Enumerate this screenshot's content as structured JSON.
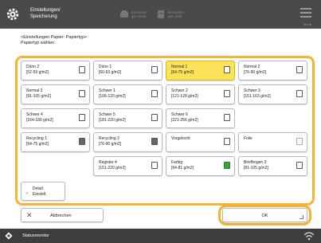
{
  "header": {
    "title_line1": "Einstellungen/",
    "title_line2": "Speicherung",
    "btn1_line1": "Einstellun-",
    "btn1_line2": "gen kontr.",
    "btn2_line1": "Einstellun-",
    "btn2_line2": "gen abbr.",
    "menu_label": "Menü"
  },
  "instructions": {
    "line1": "<Einstellungen Papier: Papiertyp>",
    "line2": "Papiertyp wählen."
  },
  "paper_types": [
    {
      "name": "Dünn 2",
      "range": "[52-59 g/m2]",
      "selected": false
    },
    {
      "name": "Dünn 1",
      "range": "[60-63 g/m2]",
      "selected": false
    },
    {
      "name": "Normal 1",
      "range": "[64-75 g/m2]",
      "selected": true
    },
    {
      "name": "Normal 2",
      "range": "[76-90 g/m2]",
      "selected": false
    },
    {
      "name": "Normal 3",
      "range": "[91-105 g/m2]",
      "selected": false
    },
    {
      "name": "Schwer 1",
      "range": "[106-120 g/m2]",
      "selected": false
    },
    {
      "name": "Schwer 2",
      "range": "[121-128 g/m2]",
      "selected": false
    },
    {
      "name": "Schwer 3",
      "range": "[151-163 g/m2]",
      "selected": false
    },
    {
      "name": "Schwer 4",
      "range": "[164-180 g/m2]",
      "selected": false
    },
    {
      "name": "Schwer 5",
      "range": "[181-220 g/m2]",
      "selected": false
    },
    {
      "name": "Schwer 6",
      "range": "[221-256 g/m2]",
      "selected": false
    },
    {
      "name": "",
      "range": "",
      "selected": false
    },
    {
      "name": "Recycling 1",
      "range": "[64-75 g/m2]",
      "selected": false
    },
    {
      "name": "Recycling 2",
      "range": "[76-90 g/m2]",
      "selected": false
    },
    {
      "name": "Vorgelocht",
      "range": "",
      "selected": false
    },
    {
      "name": "Folie",
      "range": "",
      "selected": false
    },
    {
      "name": "",
      "range": "",
      "selected": false
    },
    {
      "name": "Register 4",
      "range": "[151-220 g/m2]",
      "selected": false
    },
    {
      "name": "Farbig",
      "range": "[64-81 g/m2]",
      "selected": false
    },
    {
      "name": "Briefbogen 3",
      "range": "[81-105 g/m2]",
      "selected": false
    }
  ],
  "detail_button": {
    "line1": "Detail.",
    "line2": "Einstell."
  },
  "cancel_button": {
    "label": "Abbrechen"
  },
  "ok_button": {
    "label": "OK"
  },
  "footer": {
    "label": "Statusmonitor"
  },
  "colors": {
    "accent": "#f5b335",
    "selected": "#fae35a",
    "header": "#4a4a4a"
  }
}
